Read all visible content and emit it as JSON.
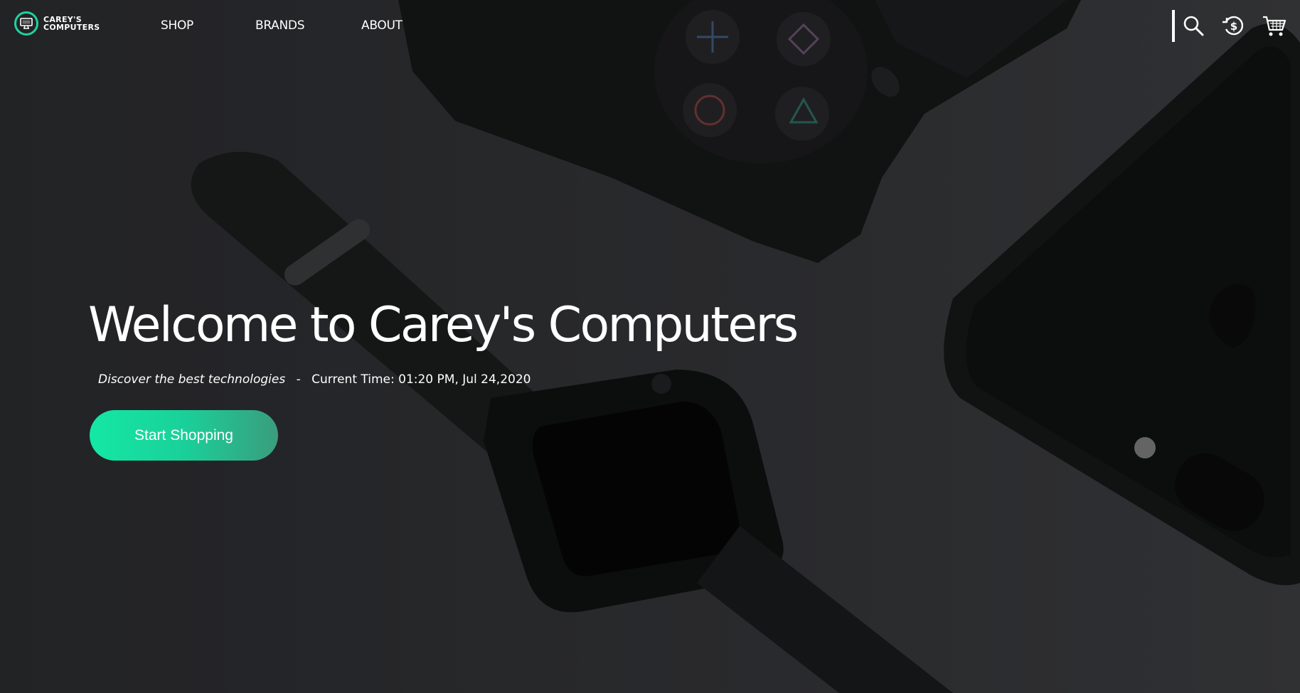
{
  "brand": {
    "line1": "CAREY'S",
    "line2": "COMPUTERS",
    "accent_color": "#1dd3a0"
  },
  "nav": {
    "links": [
      "SHOP",
      "BRANDS",
      "ABOUT"
    ],
    "icons": [
      "search-icon",
      "currency-exchange-icon",
      "shopping-cart-icon"
    ]
  },
  "hero": {
    "title": "Welcome to Carey's Computers",
    "tagline": "Discover the best technologies",
    "separator": "-",
    "time_label": "Current Time: 01:20 PM, Jul 24,2020",
    "cta_label": "Start Shopping",
    "cta_gradient": [
      "#14e8a4",
      "#3a9d7c"
    ]
  }
}
